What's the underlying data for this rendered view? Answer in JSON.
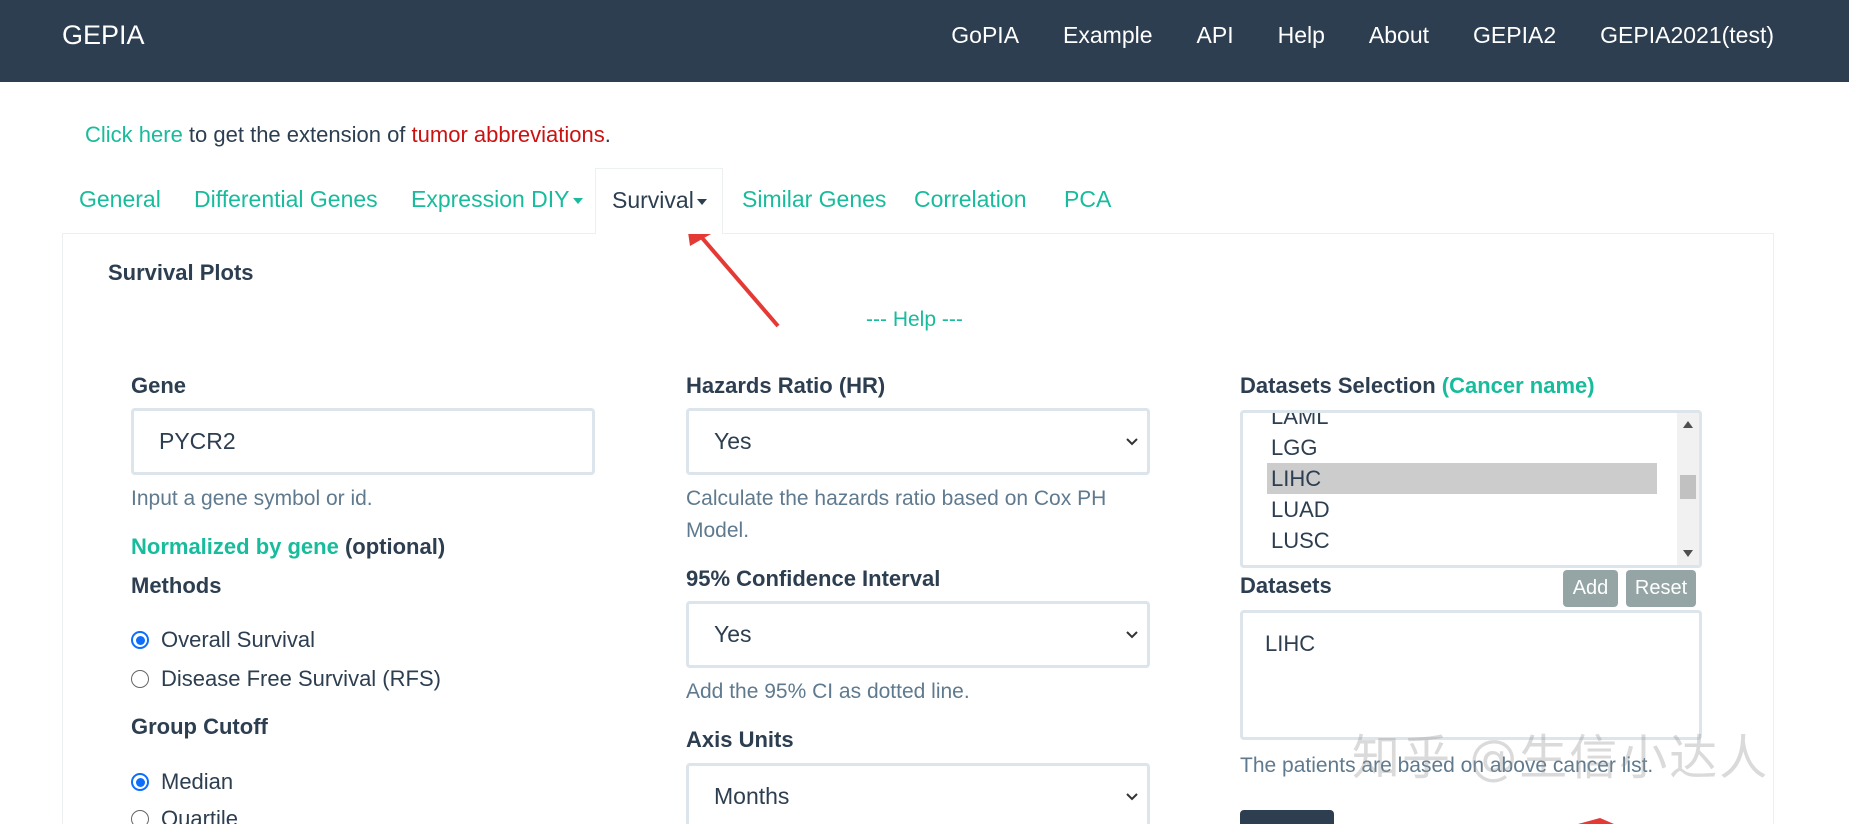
{
  "navbar": {
    "brand": "GEPIA",
    "links": [
      "GoPIA",
      "Example",
      "API",
      "Help",
      "About",
      "GEPIA2",
      "GEPIA2021(test)"
    ]
  },
  "notice": {
    "link": "Click here",
    "middle": " to get the extension of ",
    "abbr": "tumor abbreviations",
    "end": "."
  },
  "tabs": [
    "General",
    "Differential Genes",
    "Expression DIY",
    "Survival",
    "Similar Genes",
    "Correlation",
    "PCA"
  ],
  "panel": {
    "title": "Survival Plots",
    "help": "--- Help ---"
  },
  "gene": {
    "label": "Gene",
    "value": "PYCR2",
    "hint": "Input a gene symbol or id.",
    "normalized_link": "Normalized by gene",
    "normalized_optional": " (optional)"
  },
  "methods": {
    "label": "Methods",
    "options": [
      "Overall Survival",
      "Disease Free Survival (RFS)"
    ]
  },
  "group_cutoff": {
    "label": "Group Cutoff",
    "options": [
      "Median",
      "Quartile"
    ]
  },
  "hr": {
    "label": "Hazards Ratio (HR)",
    "value": "Yes",
    "hint_line1": "Calculate the hazards ratio based on Cox PH",
    "hint_line2": "Model."
  },
  "ci": {
    "label": "95% Confidence Interval",
    "value": "Yes",
    "hint": "Add the 95% CI as dotted line."
  },
  "axis": {
    "label": "Axis Units",
    "value": "Months"
  },
  "datasets_selection": {
    "label": "Datasets Selection",
    "label_link": "(Cancer name)",
    "items": [
      "LAML",
      "LGG",
      "LIHC",
      "LUAD",
      "LUSC"
    ],
    "selected": "LIHC"
  },
  "datasets": {
    "label": "Datasets",
    "add": "Add",
    "reset": "Reset",
    "value": "LIHC",
    "hint": "The patients are based on above cancer list."
  },
  "watermark": "知乎 @生信小达人",
  "colors": {
    "navbar": "#2c3e50",
    "accent": "#18bc9c",
    "link_red": "#cc1111",
    "annotation_arrow": "#e53935"
  }
}
